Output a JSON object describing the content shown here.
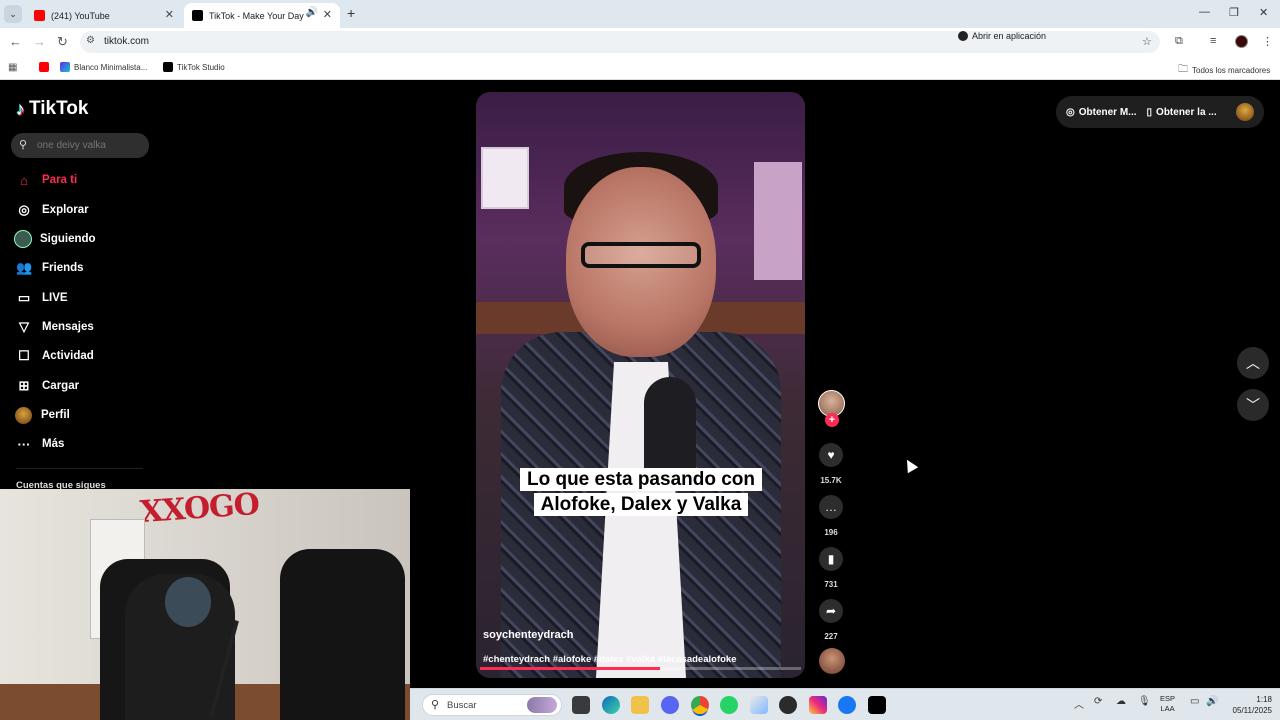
{
  "browser": {
    "tabs": [
      {
        "title": "(241) YouTube",
        "active": false,
        "color": "#ff0000"
      },
      {
        "title": "TikTok - Make Your Day",
        "active": true,
        "color": "#000000"
      }
    ],
    "url": "tiktok.com",
    "open_in_app": "Abrir en aplicación",
    "bookmarks": [
      {
        "label": "Blanco Minimalista..."
      },
      {
        "label": "TikTok Studio"
      }
    ],
    "all_bookmarks": "Todos los marcadores"
  },
  "tiktok": {
    "logo": "TikTok",
    "search_placeholder": "one deivy valka",
    "nav": [
      {
        "label": "Para ti",
        "icon": "home-icon"
      },
      {
        "label": "Explorar",
        "icon": "compass-icon"
      },
      {
        "label": "Siguiendo",
        "icon": "avatar"
      },
      {
        "label": "Friends",
        "icon": "friends-icon"
      },
      {
        "label": "LIVE",
        "icon": "live-icon"
      },
      {
        "label": "Mensajes",
        "icon": "message-icon"
      },
      {
        "label": "Actividad",
        "icon": "activity-icon"
      },
      {
        "label": "Cargar",
        "icon": "upload-icon"
      },
      {
        "label": "Perfil",
        "icon": "avatar"
      },
      {
        "label": "Más",
        "icon": "more-icon"
      }
    ],
    "following_title": "Cuentas que sigues",
    "top_pills": [
      "Obtener M...",
      "Obtener la ..."
    ],
    "accent": "#fe2c55"
  },
  "video": {
    "caption_line1": "Lo que esta pasando con",
    "caption_line2": "Alofoke, Dalex y Valka",
    "author": "soychenteydrach",
    "tags": "#chenteydrach #alofoke #dalex #valka #lacasadealofoke",
    "progress": 0.56,
    "likes": "15.7K",
    "comments": "196",
    "saves": "731",
    "shares": "227"
  },
  "taskbar": {
    "search": "Buscar",
    "lang_line1": "ESP",
    "lang_line2": "LAA",
    "time": "1:18",
    "date": "05/11/2025"
  }
}
